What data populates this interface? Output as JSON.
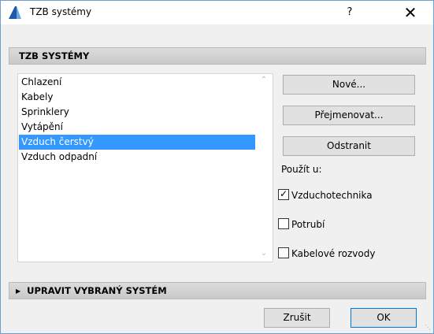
{
  "window": {
    "title": "TZB systémy",
    "help": "?",
    "close": "✕"
  },
  "section_top": {
    "title": "TZB SYSTÉMY"
  },
  "systems": {
    "items": [
      "Chlazení",
      "Kabely",
      "Sprinklery",
      "Vytápění",
      "Vzduch čerstvý",
      "Vzduch odpadní"
    ],
    "selected": "Vzduch čerstvý"
  },
  "buttons": {
    "new": "Nové...",
    "rename": "Přejmenovat...",
    "delete": "Odstranit",
    "cancel": "Zrušit",
    "ok": "OK"
  },
  "use_in": {
    "label": "Použít u:",
    "options": [
      {
        "label": "Vzduchotechnika",
        "checked": true
      },
      {
        "label": "Potrubí",
        "checked": false
      },
      {
        "label": "Kabelové rozvody",
        "checked": false
      }
    ]
  },
  "section_bottom": {
    "title": "UPRAVIT VYBRANÝ SYSTÉM"
  },
  "colors": {
    "selection": "#3399ff",
    "window_border": "#6f9fcf"
  },
  "icons": {
    "app": "archicad-logo-icon",
    "scroll_up": "chevron-up-icon",
    "scroll_down": "chevron-down-icon"
  }
}
